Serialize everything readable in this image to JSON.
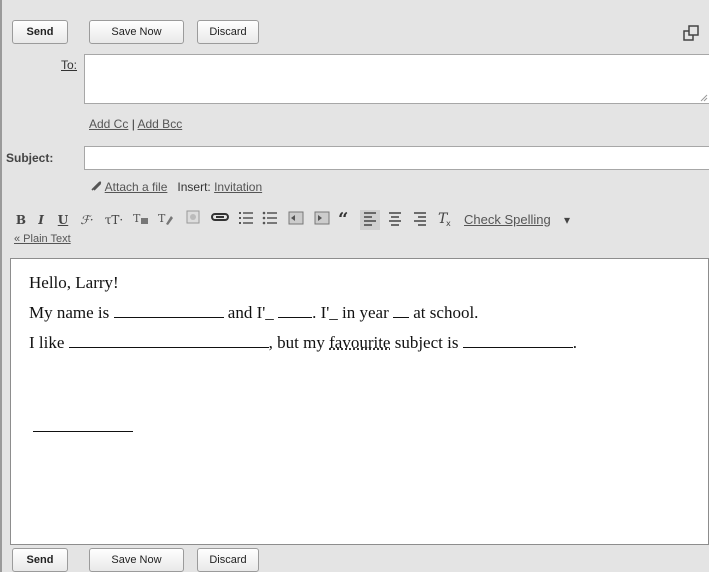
{
  "top_buttons": {
    "send": "Send",
    "save_now": "Save Now",
    "discard": "Discard"
  },
  "bottom_buttons": {
    "send": "Send",
    "save_now": "Save Now",
    "discard": "Discard"
  },
  "to": {
    "label": "To:",
    "value": ""
  },
  "cc_bcc": {
    "add_cc": "Add Cc",
    "separator": "|",
    "add_bcc": "Add Bcc"
  },
  "subject": {
    "label": "Subject:",
    "value": ""
  },
  "attach": {
    "attach_label": "Attach a file",
    "insert_label": "Insert:",
    "invitation": "Invitation"
  },
  "toolbar": {
    "bold": "B",
    "italic": "I",
    "underline": "U",
    "font": "ℱ·",
    "size": "τT·",
    "check_spelling": "Check Spelling",
    "check_arrow": "▾",
    "plain_text": "« Plain Text"
  },
  "body": {
    "line1": "Hello, Larry!",
    "line2_a": "My name is ",
    "line2_b": " and I'_ ",
    "line2_c": ". I'_ in year ",
    "line2_d": " at school.",
    "line3_a": "I like ",
    "line3_b": ", but my ",
    "line3_word": "favourite",
    "line3_c": " subject is ",
    "line3_d": "."
  },
  "icons": {
    "popout": "popout-icon"
  }
}
